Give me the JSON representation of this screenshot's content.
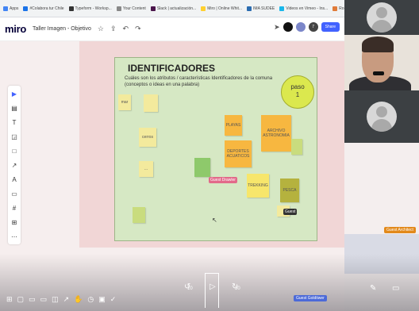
{
  "browser": {
    "bookmarks": [
      {
        "label": "Apps",
        "color": "#4285f4"
      },
      {
        "label": "#Colabora tur Chile",
        "color": "#1a73e8"
      },
      {
        "label": "Typeform - Worksp...",
        "color": "#333333"
      },
      {
        "label": "Your Content",
        "color": "#888888"
      },
      {
        "label": "Slack | actualización...",
        "color": "#4a154b"
      },
      {
        "label": "Miro | Online Whit...",
        "color": "#ffd02f"
      },
      {
        "label": "IMA SUDEE",
        "color": "#2b6cb0"
      },
      {
        "label": "Videos en Vimeo - Ins...",
        "color": "#1ab7ea"
      },
      {
        "label": "Roundcube Webm...",
        "color": "#e07b39"
      }
    ]
  },
  "miro": {
    "logo": "miro",
    "board_title": "Taller Imagen - Objetivo",
    "share_label": "Share",
    "users_count": "7"
  },
  "board": {
    "title": "IDENTIFICADORES",
    "subtitle": "Cuáles son los atributos / características Identificadores de la comuna (conceptos o ideas en una palabra)",
    "notes": [
      {
        "text": "mar"
      },
      {
        "text": ""
      },
      {
        "text": "cerros"
      },
      {
        "text": "..."
      },
      {
        "text": ""
      },
      {
        "text": "PLAYAS"
      },
      {
        "text": "ARCHIVO ASTRONOMIA"
      },
      {
        "text": ""
      },
      {
        "text": "DEPORTES ACUATICOS"
      },
      {
        "text": ""
      },
      {
        "text": "TREKKING"
      },
      {
        "text": "PESCA"
      },
      {
        "text": ""
      },
      {
        "text": ""
      }
    ],
    "guest_tag": "Guest Drawler",
    "guest_tag2": "Guest"
  },
  "paso": {
    "line1": "paso",
    "line2": "1"
  },
  "player": {
    "rewind": "10",
    "forward": "30"
  },
  "tags": {
    "blue": "Guest Goldtiwer",
    "orange": "Guest Architect"
  },
  "colors": {
    "accent": "#4262ff",
    "board_bg": "#d6e8c4"
  }
}
